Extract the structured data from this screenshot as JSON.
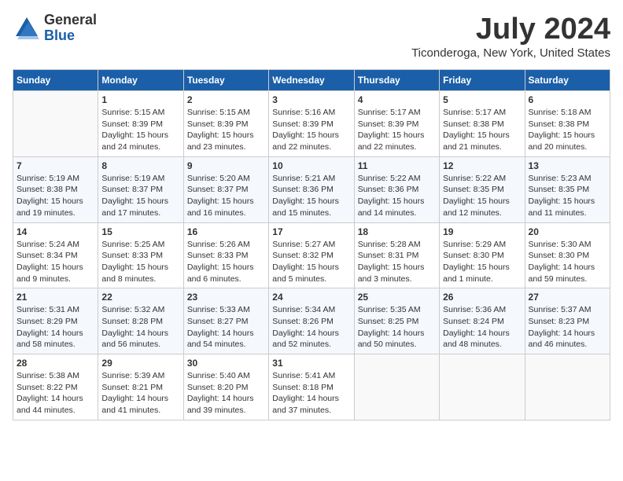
{
  "logo": {
    "general": "General",
    "blue": "Blue"
  },
  "title": {
    "month_year": "July 2024",
    "location": "Ticonderoga, New York, United States"
  },
  "headers": [
    "Sunday",
    "Monday",
    "Tuesday",
    "Wednesday",
    "Thursday",
    "Friday",
    "Saturday"
  ],
  "weeks": [
    [
      {
        "day": "",
        "info": ""
      },
      {
        "day": "1",
        "info": "Sunrise: 5:15 AM\nSunset: 8:39 PM\nDaylight: 15 hours\nand 24 minutes."
      },
      {
        "day": "2",
        "info": "Sunrise: 5:15 AM\nSunset: 8:39 PM\nDaylight: 15 hours\nand 23 minutes."
      },
      {
        "day": "3",
        "info": "Sunrise: 5:16 AM\nSunset: 8:39 PM\nDaylight: 15 hours\nand 22 minutes."
      },
      {
        "day": "4",
        "info": "Sunrise: 5:17 AM\nSunset: 8:39 PM\nDaylight: 15 hours\nand 22 minutes."
      },
      {
        "day": "5",
        "info": "Sunrise: 5:17 AM\nSunset: 8:38 PM\nDaylight: 15 hours\nand 21 minutes."
      },
      {
        "day": "6",
        "info": "Sunrise: 5:18 AM\nSunset: 8:38 PM\nDaylight: 15 hours\nand 20 minutes."
      }
    ],
    [
      {
        "day": "7",
        "info": "Sunrise: 5:19 AM\nSunset: 8:38 PM\nDaylight: 15 hours\nand 19 minutes."
      },
      {
        "day": "8",
        "info": "Sunrise: 5:19 AM\nSunset: 8:37 PM\nDaylight: 15 hours\nand 17 minutes."
      },
      {
        "day": "9",
        "info": "Sunrise: 5:20 AM\nSunset: 8:37 PM\nDaylight: 15 hours\nand 16 minutes."
      },
      {
        "day": "10",
        "info": "Sunrise: 5:21 AM\nSunset: 8:36 PM\nDaylight: 15 hours\nand 15 minutes."
      },
      {
        "day": "11",
        "info": "Sunrise: 5:22 AM\nSunset: 8:36 PM\nDaylight: 15 hours\nand 14 minutes."
      },
      {
        "day": "12",
        "info": "Sunrise: 5:22 AM\nSunset: 8:35 PM\nDaylight: 15 hours\nand 12 minutes."
      },
      {
        "day": "13",
        "info": "Sunrise: 5:23 AM\nSunset: 8:35 PM\nDaylight: 15 hours\nand 11 minutes."
      }
    ],
    [
      {
        "day": "14",
        "info": "Sunrise: 5:24 AM\nSunset: 8:34 PM\nDaylight: 15 hours\nand 9 minutes."
      },
      {
        "day": "15",
        "info": "Sunrise: 5:25 AM\nSunset: 8:33 PM\nDaylight: 15 hours\nand 8 minutes."
      },
      {
        "day": "16",
        "info": "Sunrise: 5:26 AM\nSunset: 8:33 PM\nDaylight: 15 hours\nand 6 minutes."
      },
      {
        "day": "17",
        "info": "Sunrise: 5:27 AM\nSunset: 8:32 PM\nDaylight: 15 hours\nand 5 minutes."
      },
      {
        "day": "18",
        "info": "Sunrise: 5:28 AM\nSunset: 8:31 PM\nDaylight: 15 hours\nand 3 minutes."
      },
      {
        "day": "19",
        "info": "Sunrise: 5:29 AM\nSunset: 8:30 PM\nDaylight: 15 hours\nand 1 minute."
      },
      {
        "day": "20",
        "info": "Sunrise: 5:30 AM\nSunset: 8:30 PM\nDaylight: 14 hours\nand 59 minutes."
      }
    ],
    [
      {
        "day": "21",
        "info": "Sunrise: 5:31 AM\nSunset: 8:29 PM\nDaylight: 14 hours\nand 58 minutes."
      },
      {
        "day": "22",
        "info": "Sunrise: 5:32 AM\nSunset: 8:28 PM\nDaylight: 14 hours\nand 56 minutes."
      },
      {
        "day": "23",
        "info": "Sunrise: 5:33 AM\nSunset: 8:27 PM\nDaylight: 14 hours\nand 54 minutes."
      },
      {
        "day": "24",
        "info": "Sunrise: 5:34 AM\nSunset: 8:26 PM\nDaylight: 14 hours\nand 52 minutes."
      },
      {
        "day": "25",
        "info": "Sunrise: 5:35 AM\nSunset: 8:25 PM\nDaylight: 14 hours\nand 50 minutes."
      },
      {
        "day": "26",
        "info": "Sunrise: 5:36 AM\nSunset: 8:24 PM\nDaylight: 14 hours\nand 48 minutes."
      },
      {
        "day": "27",
        "info": "Sunrise: 5:37 AM\nSunset: 8:23 PM\nDaylight: 14 hours\nand 46 minutes."
      }
    ],
    [
      {
        "day": "28",
        "info": "Sunrise: 5:38 AM\nSunset: 8:22 PM\nDaylight: 14 hours\nand 44 minutes."
      },
      {
        "day": "29",
        "info": "Sunrise: 5:39 AM\nSunset: 8:21 PM\nDaylight: 14 hours\nand 41 minutes."
      },
      {
        "day": "30",
        "info": "Sunrise: 5:40 AM\nSunset: 8:20 PM\nDaylight: 14 hours\nand 39 minutes."
      },
      {
        "day": "31",
        "info": "Sunrise: 5:41 AM\nSunset: 8:18 PM\nDaylight: 14 hours\nand 37 minutes."
      },
      {
        "day": "",
        "info": ""
      },
      {
        "day": "",
        "info": ""
      },
      {
        "day": "",
        "info": ""
      }
    ]
  ]
}
